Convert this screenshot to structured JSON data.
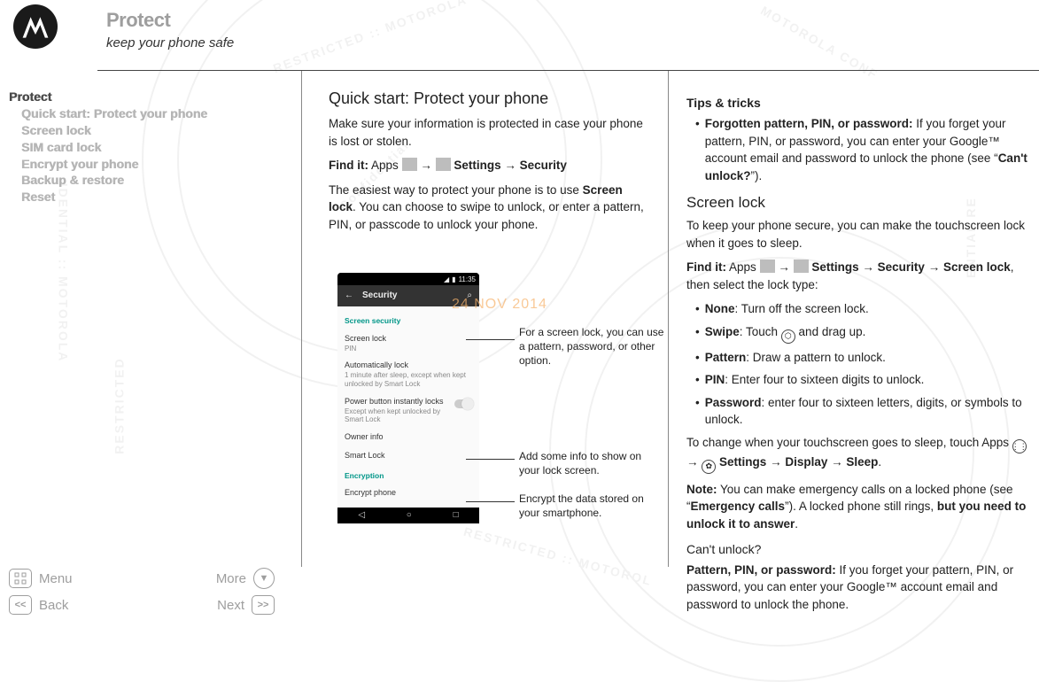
{
  "header": {
    "title": "Protect",
    "subtitle": "keep your phone safe"
  },
  "sidebar": {
    "items": [
      {
        "label": "Protect",
        "indent": false,
        "active": true
      },
      {
        "label": "Quick start: Protect your phone",
        "indent": true,
        "active": false
      },
      {
        "label": "Screen lock",
        "indent": true,
        "active": false
      },
      {
        "label": "SIM card lock",
        "indent": true,
        "active": false
      },
      {
        "label": "Encrypt your phone",
        "indent": true,
        "active": false
      },
      {
        "label": "Backup & restore",
        "indent": true,
        "active": false
      },
      {
        "label": "Reset",
        "indent": true,
        "active": false
      }
    ]
  },
  "main": {
    "h2": "Quick start: Protect your phone",
    "intro": "Make sure your information is protected in case your phone is lost or stolen.",
    "findit_label": "Find it:",
    "findit_apps": "Apps",
    "findit_settings": "Settings",
    "findit_security": "Security",
    "body1a": "The easiest way to protect your phone is to use ",
    "body1b": "Screen lock",
    "body1c": ". You can choose to swipe to unlock, or enter a pattern, PIN, or passcode to unlock your phone."
  },
  "date_stamp": "24 NOV 2014",
  "phone": {
    "time": "11:35",
    "appbar_title": "Security",
    "sect1": "Screen security",
    "rows": {
      "screen_lock": {
        "t": "Screen lock",
        "s": "PIN"
      },
      "auto_lock": {
        "t": "Automatically lock",
        "s": "1 minute after sleep, except when kept unlocked by Smart Lock"
      },
      "power_lock": {
        "t": "Power button instantly locks",
        "s": "Except when kept unlocked by Smart Lock"
      },
      "owner": {
        "t": "Owner info"
      },
      "smart": {
        "t": "Smart Lock"
      }
    },
    "sect2": "Encryption",
    "encrypt": {
      "t": "Encrypt phone"
    }
  },
  "callouts": {
    "c1": "For a screen lock, you can use a pattern, password, or other option.",
    "c2": "Add some info to show on your lock screen.",
    "c3": "Encrypt the data stored on your smartphone."
  },
  "right": {
    "tips_title": "Tips & tricks",
    "tip1_label": "Forgotten pattern, PIN, or password:",
    "tip1_body": " If you forget your pattern, PIN, or password, you can enter your Google™ account email and password to unlock the phone (see “",
    "tip1_link": "Can't unlock?",
    "tip1_end": "”).",
    "screenlock_h": "Screen lock",
    "sl_intro": "To keep your phone secure, you can make the touchscreen lock when it goes to sleep.",
    "findit_label": "Find it:",
    "findit_apps": "Apps",
    "findit_settings": "Settings",
    "findit_security": "Security",
    "findit_screenlock": "Screen lock",
    "findit_tail": ", then select the lock type:",
    "opts": {
      "none_l": "None",
      "none_t": ": Turn off the screen lock.",
      "swipe_l": "Swipe",
      "swipe_t1": ": Touch ",
      "swipe_t2": " and drag up.",
      "pattern_l": "Pattern",
      "pattern_t": ": Draw a pattern to unlock.",
      "pin_l": "PIN",
      "pin_t": ": Enter four to sixteen digits to unlock.",
      "pw_l": "Password",
      "pw_t": ": enter four to sixteen letters, digits, or symbols to unlock."
    },
    "change1": "To change when your touchscreen goes to sleep, touch Apps ",
    "change_settings": "Settings",
    "change_display": "Display",
    "change_sleep": "Sleep",
    "note_l": "Note:",
    "note_1": " You can make emergency calls on a locked phone (see “",
    "note_link": "Emergency calls",
    "note_2": "”). A locked phone still rings, ",
    "note_b": "but you need to unlock it to answer",
    "note_3": ".",
    "cant_h": "Can't unlock?",
    "cant_l": "Pattern, PIN, or password:",
    "cant_t": " If you forget your pattern, PIN, or password, you can enter your Google™ account email and password to unlock the phone."
  },
  "bottomnav": {
    "menu": "Menu",
    "more": "More",
    "back": "Back",
    "next": "Next"
  }
}
